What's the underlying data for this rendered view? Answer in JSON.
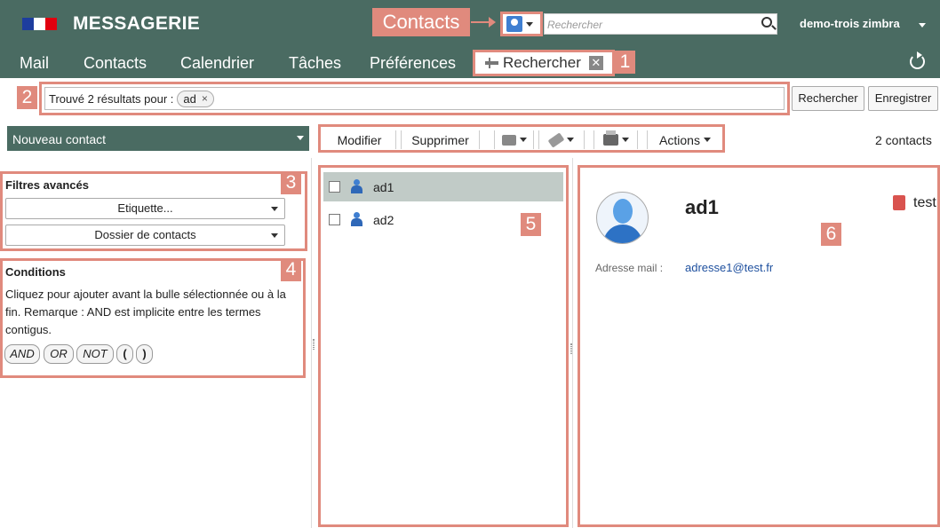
{
  "header": {
    "app_title": "MESSAGERIE",
    "search_placeholder": "Rechercher",
    "user": "demo-trois zimbra",
    "callout_label": "Contacts"
  },
  "tabs": [
    "Mail",
    "Contacts",
    "Calendrier",
    "Tâches",
    "Préférences"
  ],
  "active_tab": {
    "label": "Rechercher",
    "close": "✕"
  },
  "badges": [
    "1",
    "2",
    "3",
    "4",
    "5",
    "6"
  ],
  "query": {
    "label": "Trouvé 2 résultats pour :",
    "term": "ad",
    "remove": "×",
    "search_button": "Rechercher",
    "save_button": "Enregistrer"
  },
  "new_contact": "Nouveau contact",
  "toolbar": {
    "edit": "Modifier",
    "delete": "Supprimer",
    "actions": "Actions"
  },
  "count": "2 contacts",
  "filters": {
    "title": "Filtres avancés",
    "tag": "Etiquette...",
    "folder": "Dossier de contacts"
  },
  "conditions": {
    "title": "Conditions",
    "text": "Cliquez pour ajouter avant la bulle sélectionnée ou à la fin. Remarque : AND est implicite entre les termes contigus.",
    "ops": [
      "AND",
      "OR",
      "NOT",
      "(",
      ")"
    ]
  },
  "contacts": [
    {
      "name": "ad1",
      "selected": true
    },
    {
      "name": "ad2",
      "selected": false
    }
  ],
  "detail": {
    "name": "ad1",
    "book": "test",
    "email_label": "Adresse mail :",
    "email": "adresse1@test.fr"
  },
  "colors": {
    "header_bg": "#4a6b62",
    "annotation": "#e08a7d",
    "selected_row": "#c1cbc7",
    "link": "#1d4f9e"
  }
}
